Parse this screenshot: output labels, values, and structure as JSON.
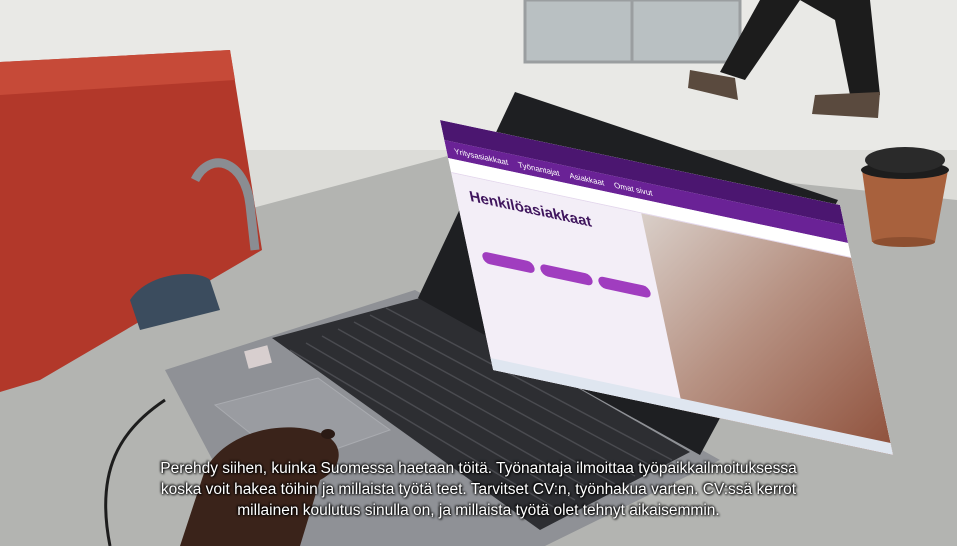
{
  "scene": {
    "colors": {
      "floor": "#d9d9d5",
      "table": "#b4b5b2",
      "chair": "#b13a2b",
      "laptop_body": "#8e9096",
      "keyboard": "#2c2d31",
      "cup": "#a8613d",
      "site_purple": "#6a2296"
    },
    "icons": [
      "laptop",
      "coffee-cup",
      "bag-strap",
      "hand",
      "person-legs"
    ]
  },
  "website": {
    "nav_items": [
      "Omat sivut",
      "Asiakkaat",
      "Työnantajat",
      "Yritysasiakkaat"
    ],
    "hero_title": "Henkilöasiakkaat"
  },
  "subtitle": {
    "line1": "Perehdy siihen, kuinka Suomessa haetaan töitä. Työnantaja ilmoittaa työpaikkailmoituksessa",
    "line2": "koska voit hakea töihin ja millaista työtä teet. Tarvitset CV:n, työnhakua varten. CV:ssä kerrot",
    "line3": "millainen koulutus sinulla on, ja millaista työtä olet tehnyt aikaisemmin."
  }
}
